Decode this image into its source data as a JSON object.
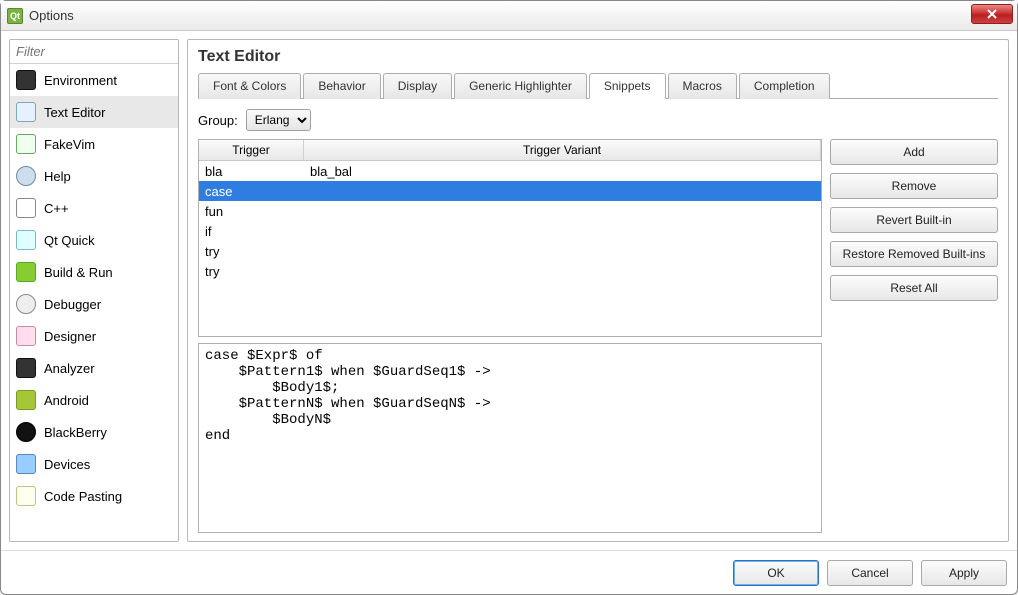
{
  "window": {
    "title": "Options"
  },
  "sidebar": {
    "filter_placeholder": "Filter",
    "items": [
      {
        "label": "Environment",
        "iconClass": "ci-env"
      },
      {
        "label": "Text Editor",
        "iconClass": "ci-txt",
        "selected": true
      },
      {
        "label": "FakeVim",
        "iconClass": "ci-fake"
      },
      {
        "label": "Help",
        "iconClass": "ci-help"
      },
      {
        "label": "C++",
        "iconClass": "ci-cpp"
      },
      {
        "label": "Qt Quick",
        "iconClass": "ci-qtq"
      },
      {
        "label": "Build & Run",
        "iconClass": "ci-build"
      },
      {
        "label": "Debugger",
        "iconClass": "ci-dbg"
      },
      {
        "label": "Designer",
        "iconClass": "ci-des"
      },
      {
        "label": "Analyzer",
        "iconClass": "ci-ana"
      },
      {
        "label": "Android",
        "iconClass": "ci-and"
      },
      {
        "label": "BlackBerry",
        "iconClass": "ci-bb"
      },
      {
        "label": "Devices",
        "iconClass": "ci-dev"
      },
      {
        "label": "Code Pasting",
        "iconClass": "ci-cp"
      }
    ]
  },
  "main": {
    "title": "Text Editor",
    "tabs": [
      {
        "label": "Font & Colors"
      },
      {
        "label": "Behavior"
      },
      {
        "label": "Display"
      },
      {
        "label": "Generic Highlighter"
      },
      {
        "label": "Snippets",
        "active": true
      },
      {
        "label": "Macros"
      },
      {
        "label": "Completion"
      }
    ],
    "group_label": "Group:",
    "group_value": "Erlang",
    "table": {
      "col_trigger": "Trigger",
      "col_variant": "Trigger Variant",
      "rows": [
        {
          "trigger": "bla",
          "variant": "bla_bal"
        },
        {
          "trigger": "case",
          "variant": "",
          "selected": true
        },
        {
          "trigger": "fun",
          "variant": ""
        },
        {
          "trigger": "if",
          "variant": ""
        },
        {
          "trigger": "try",
          "variant": ""
        },
        {
          "trigger": "try",
          "variant": ""
        }
      ]
    },
    "code": "case $Expr$ of\n    $Pattern1$ when $GuardSeq1$ ->\n        $Body1$;\n    $PatternN$ when $GuardSeqN$ ->\n        $BodyN$\nend",
    "buttons": {
      "add": "Add",
      "remove": "Remove",
      "revert": "Revert Built-in",
      "restore": "Restore Removed Built-ins",
      "reset": "Reset All"
    }
  },
  "footer": {
    "ok": "OK",
    "cancel": "Cancel",
    "apply": "Apply"
  }
}
